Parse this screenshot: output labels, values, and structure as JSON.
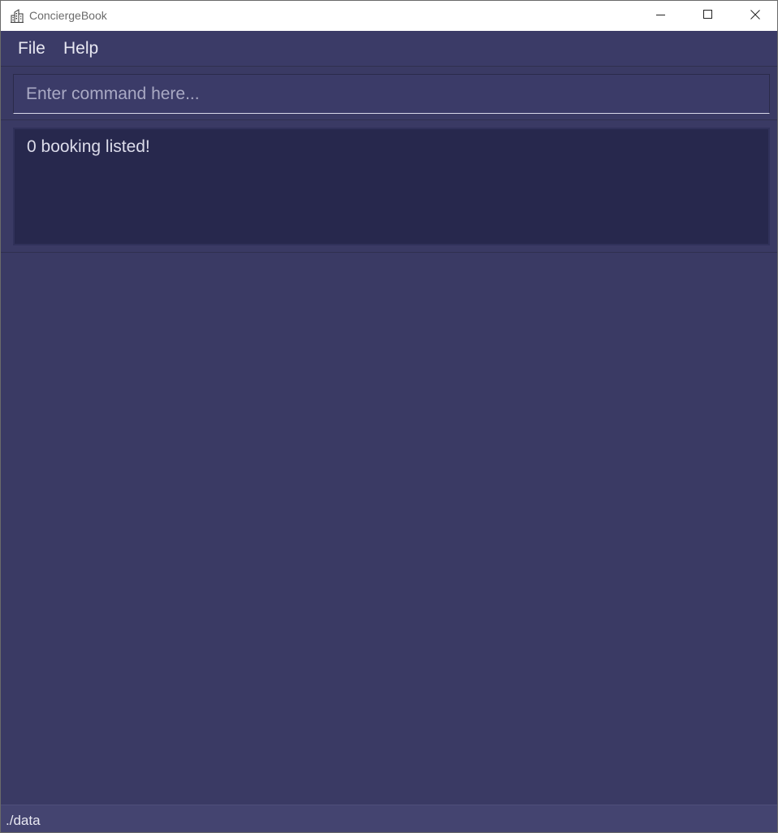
{
  "window": {
    "title": "ConciergeBook",
    "app_icon": "building-icon",
    "controls": {
      "minimize_icon": "minimize-icon",
      "maximize_icon": "maximize-icon",
      "close_icon": "close-icon"
    }
  },
  "menubar": {
    "items": [
      {
        "label": "File"
      },
      {
        "label": "Help"
      }
    ]
  },
  "command": {
    "value": "",
    "placeholder": "Enter command here..."
  },
  "result": {
    "message": "0 booking listed!"
  },
  "status": {
    "path": "./data"
  },
  "colors": {
    "background": "#3a3a64",
    "result_background": "#27284d",
    "statusbar": "#444470",
    "text": "#e8e8f2"
  }
}
